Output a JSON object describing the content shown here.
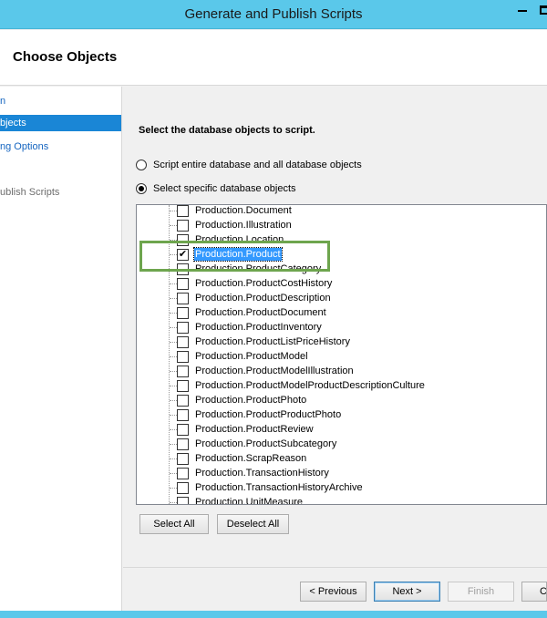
{
  "window": {
    "title": "Generate and Publish Scripts",
    "accent_color": "#5ac8ea"
  },
  "header": {
    "page_title": "Choose Objects"
  },
  "nav": {
    "items": [
      {
        "label": "n",
        "state": "link"
      },
      {
        "label": "bjects",
        "state": "selected"
      },
      {
        "label": "ng Options",
        "state": "link"
      },
      {
        "label": "ublish Scripts",
        "state": "disabled"
      }
    ]
  },
  "main": {
    "instruction": "Select the database objects to script.",
    "radio_entire": {
      "label": "Script entire database and all database objects",
      "checked": false
    },
    "radio_specific": {
      "label": "Select specific database objects",
      "checked": true
    },
    "tree_items": [
      {
        "label": "Production.Document",
        "checked": false,
        "selected": false
      },
      {
        "label": "Production.Illustration",
        "checked": false,
        "selected": false
      },
      {
        "label": "Production.Location",
        "checked": false,
        "selected": false
      },
      {
        "label": "Production.Product",
        "checked": true,
        "selected": true
      },
      {
        "label": "Production.ProductCategory",
        "checked": false,
        "selected": false
      },
      {
        "label": "Production.ProductCostHistory",
        "checked": false,
        "selected": false
      },
      {
        "label": "Production.ProductDescription",
        "checked": false,
        "selected": false
      },
      {
        "label": "Production.ProductDocument",
        "checked": false,
        "selected": false
      },
      {
        "label": "Production.ProductInventory",
        "checked": false,
        "selected": false
      },
      {
        "label": "Production.ProductListPriceHistory",
        "checked": false,
        "selected": false
      },
      {
        "label": "Production.ProductModel",
        "checked": false,
        "selected": false
      },
      {
        "label": "Production.ProductModelIllustration",
        "checked": false,
        "selected": false
      },
      {
        "label": "Production.ProductModelProductDescriptionCulture",
        "checked": false,
        "selected": false
      },
      {
        "label": "Production.ProductPhoto",
        "checked": false,
        "selected": false
      },
      {
        "label": "Production.ProductProductPhoto",
        "checked": false,
        "selected": false
      },
      {
        "label": "Production.ProductReview",
        "checked": false,
        "selected": false
      },
      {
        "label": "Production.ProductSubcategory",
        "checked": false,
        "selected": false
      },
      {
        "label": "Production.ScrapReason",
        "checked": false,
        "selected": false
      },
      {
        "label": "Production.TransactionHistory",
        "checked": false,
        "selected": false
      },
      {
        "label": "Production.TransactionHistoryArchive",
        "checked": false,
        "selected": false
      },
      {
        "label": "Production.UnitMeasure",
        "checked": false,
        "selected": false
      }
    ],
    "select_all_label": "Select All",
    "deselect_all_label": "Deselect All"
  },
  "footer": {
    "previous_label": "< Previous",
    "next_label": "Next >",
    "finish_label": "Finish",
    "cancel_label": "Cancel"
  },
  "callout_color": "#6ea54e"
}
